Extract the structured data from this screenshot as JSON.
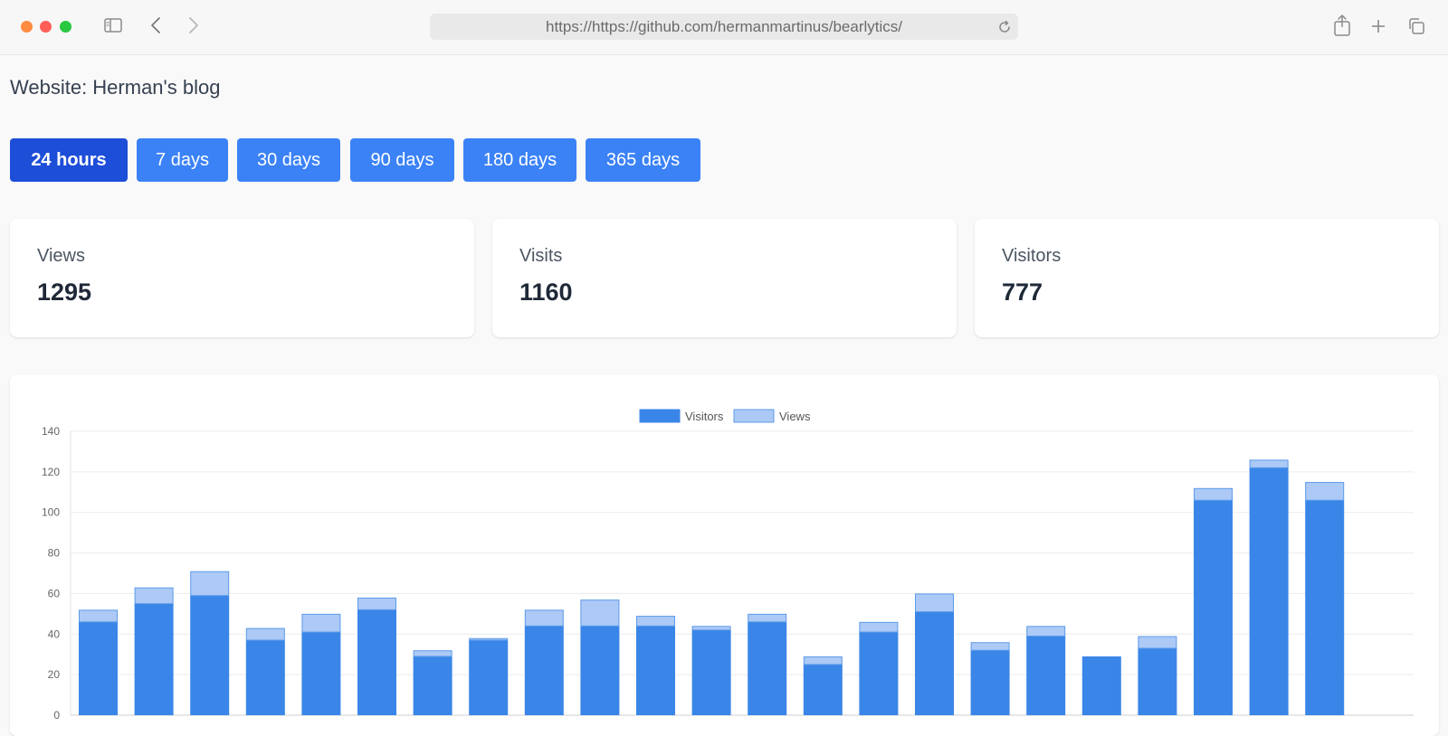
{
  "browser": {
    "url": "https://https://github.com/hermanmartinus/bearlytics/"
  },
  "page": {
    "title": "Website: Herman's blog"
  },
  "ranges": [
    {
      "label": "24 hours",
      "active": true
    },
    {
      "label": "7 days",
      "active": false
    },
    {
      "label": "30 days",
      "active": false
    },
    {
      "label": "90 days",
      "active": false
    },
    {
      "label": "180 days",
      "active": false
    },
    {
      "label": "365 days",
      "active": false
    }
  ],
  "stats": [
    {
      "label": "Views",
      "value": "1295"
    },
    {
      "label": "Visits",
      "value": "1160"
    },
    {
      "label": "Visitors",
      "value": "777"
    }
  ],
  "colors": {
    "accent": "#3b82f6",
    "accent_active": "#1d4ed8",
    "visitors": "#3a86e8",
    "views": "#adc9f6",
    "views_border": "#5b9be8"
  },
  "chart_data": {
    "type": "bar",
    "stacked": true,
    "legend": "top-center",
    "grid": true,
    "ylim": [
      0,
      140
    ],
    "yticks": [
      0,
      20,
      40,
      60,
      80,
      100,
      120,
      140
    ],
    "series": [
      {
        "name": "Visitors",
        "values": [
          46,
          55,
          59,
          37,
          41,
          52,
          29,
          37,
          44,
          44,
          44,
          42,
          46,
          25,
          41,
          51,
          32,
          39,
          29,
          33,
          106,
          122,
          106
        ]
      },
      {
        "name": "Views",
        "values": [
          6,
          8,
          12,
          6,
          9,
          6,
          3,
          1,
          8,
          13,
          5,
          2,
          4,
          4,
          5,
          9,
          4,
          5,
          0,
          6,
          6,
          4,
          9
        ]
      }
    ]
  }
}
